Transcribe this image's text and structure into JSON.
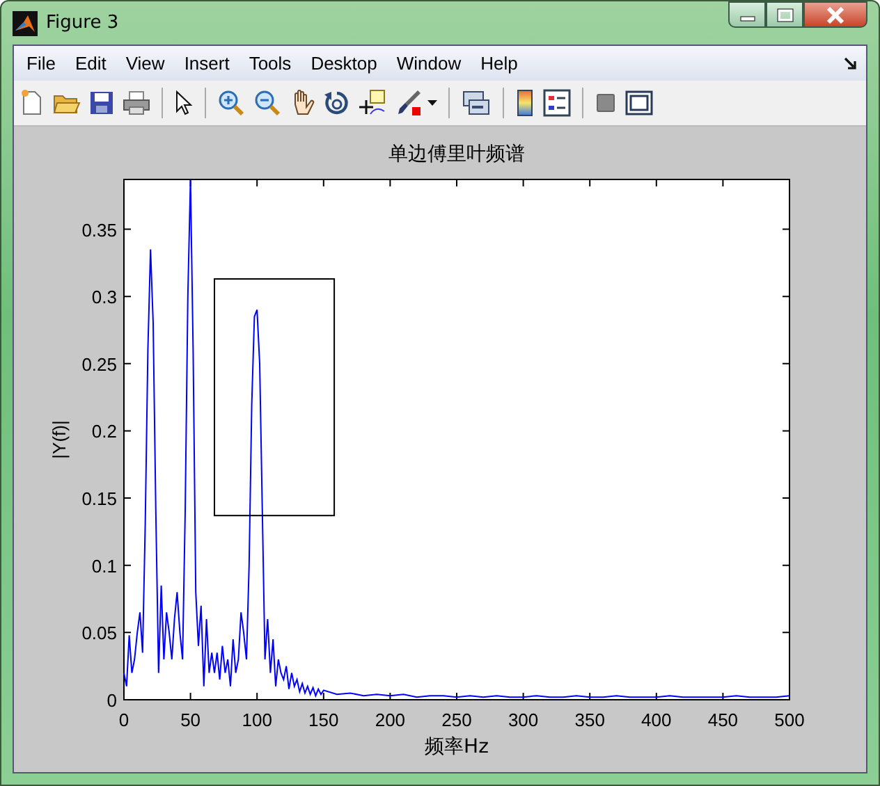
{
  "window": {
    "title": "Figure 3"
  },
  "menu": [
    "File",
    "Edit",
    "View",
    "Insert",
    "Tools",
    "Desktop",
    "Window",
    "Help"
  ],
  "figure": {
    "chart_data": {
      "type": "line",
      "title": "单边傅里叶频谱",
      "xlabel": "频率Hz",
      "ylabel": "|Y(f)|",
      "xlim": [
        0,
        500
      ],
      "ylim": [
        0,
        0.387
      ],
      "xticks": [
        0,
        50,
        100,
        150,
        200,
        250,
        300,
        350,
        400,
        450,
        500
      ],
      "yticks": [
        0,
        0.05,
        0.1,
        0.15,
        0.2,
        0.25,
        0.3,
        0.35
      ],
      "x": [
        0,
        2,
        4,
        6,
        8,
        10,
        12,
        14,
        16,
        18,
        20,
        22,
        24,
        26,
        28,
        30,
        32,
        34,
        36,
        38,
        40,
        42,
        44,
        46,
        48,
        50,
        52,
        54,
        56,
        58,
        60,
        62,
        64,
        66,
        68,
        70,
        72,
        74,
        76,
        78,
        80,
        82,
        84,
        86,
        88,
        90,
        92,
        94,
        96,
        98,
        100,
        102,
        104,
        106,
        108,
        110,
        112,
        114,
        116,
        118,
        120,
        122,
        124,
        126,
        128,
        130,
        132,
        134,
        136,
        138,
        140,
        142,
        144,
        146,
        148,
        150,
        160,
        170,
        180,
        190,
        200,
        210,
        220,
        230,
        240,
        250,
        260,
        270,
        280,
        290,
        300,
        310,
        320,
        330,
        340,
        350,
        360,
        370,
        380,
        390,
        400,
        410,
        420,
        430,
        440,
        450,
        460,
        470,
        480,
        490,
        500
      ],
      "series": [
        {
          "color": "#0000ff",
          "values": [
            0.02,
            0.01,
            0.048,
            0.02,
            0.03,
            0.05,
            0.065,
            0.035,
            0.13,
            0.26,
            0.335,
            0.28,
            0.14,
            0.02,
            0.085,
            0.03,
            0.065,
            0.05,
            0.03,
            0.06,
            0.08,
            0.05,
            0.03,
            0.14,
            0.3,
            0.387,
            0.26,
            0.08,
            0.04,
            0.07,
            0.01,
            0.06,
            0.02,
            0.035,
            0.02,
            0.035,
            0.015,
            0.04,
            0.02,
            0.03,
            0.01,
            0.045,
            0.02,
            0.03,
            0.065,
            0.05,
            0.03,
            0.1,
            0.22,
            0.285,
            0.29,
            0.25,
            0.14,
            0.03,
            0.06,
            0.02,
            0.045,
            0.01,
            0.03,
            0.02,
            0.015,
            0.025,
            0.008,
            0.02,
            0.01,
            0.015,
            0.006,
            0.012,
            0.005,
            0.01,
            0.004,
            0.009,
            0.003,
            0.008,
            0.004,
            0.007,
            0.004,
            0.005,
            0.003,
            0.004,
            0.003,
            0.004,
            0.002,
            0.003,
            0.003,
            0.002,
            0.003,
            0.002,
            0.003,
            0.002,
            0.002,
            0.003,
            0.002,
            0.002,
            0.003,
            0.002,
            0.002,
            0.003,
            0.002,
            0.002,
            0.002,
            0.003,
            0.002,
            0.002,
            0.002,
            0.002,
            0.003,
            0.002,
            0.002,
            0.002,
            0.003
          ]
        }
      ]
    }
  }
}
